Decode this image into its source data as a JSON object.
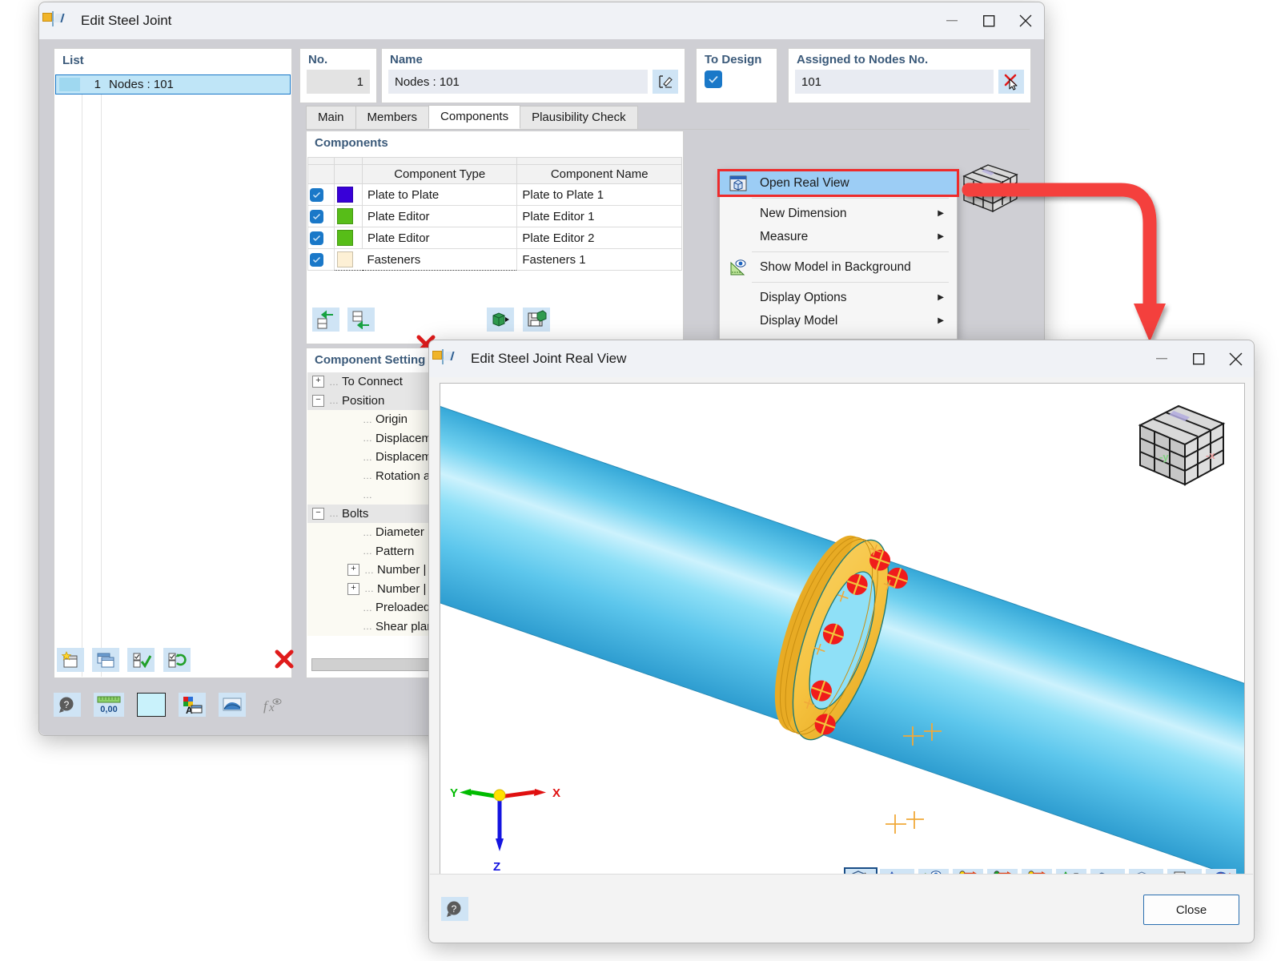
{
  "main_window": {
    "title": "Edit Steel Joint",
    "icon": "steel-joint-icon",
    "controls": {
      "minimize": "—",
      "maximize": "☐",
      "close": "✕"
    },
    "list_panel": {
      "header": "List",
      "rows": [
        {
          "num": "1",
          "label": "Nodes : 101",
          "color": "#9fd8f0"
        }
      ]
    },
    "fields": {
      "no_label": "No.",
      "no_value": "1",
      "name_label": "Name",
      "name_value": "Nodes : 101",
      "name_edit_icon": "edit-pencil-icon",
      "to_design_label": "To Design",
      "to_design_checked": true,
      "assigned_label": "Assigned to Nodes No.",
      "assigned_value": "101",
      "assigned_pick_icon": "select-nodes-icon"
    },
    "tabs": [
      {
        "label": "Main",
        "active": false
      },
      {
        "label": "Members",
        "active": false
      },
      {
        "label": "Components",
        "active": true
      },
      {
        "label": "Plausibility Check",
        "active": false
      }
    ],
    "components_panel": {
      "header": "Components",
      "columns": [
        "",
        "",
        "Component Type",
        "Component Name"
      ],
      "rows": [
        {
          "checked": true,
          "color": "#3800d8",
          "type": "Plate to Plate",
          "name": "Plate to Plate 1",
          "selected": false
        },
        {
          "checked": true,
          "color": "#57bd18",
          "type": "Plate Editor",
          "name": "Plate Editor 1",
          "selected": false
        },
        {
          "checked": true,
          "color": "#57bd18",
          "type": "Plate Editor",
          "name": "Plate Editor 2",
          "selected": false
        },
        {
          "checked": true,
          "color": "#fdf0d5",
          "type": "Fasteners",
          "name": "Fasteners 1",
          "selected": true
        }
      ],
      "toolbar": [
        {
          "name": "move-component-up-icon",
          "glyph": "⇦"
        },
        {
          "name": "move-component-down-icon",
          "glyph": "⇦"
        },
        {
          "name": "import-component-icon",
          "glyph": "▣"
        },
        {
          "name": "save-component-icon",
          "glyph": "Ὃe"
        },
        {
          "name": "delete-component-icon",
          "glyph": "✕"
        }
      ]
    },
    "component_settings": {
      "header": "Component Setting",
      "nodes": [
        {
          "label": "To Connect",
          "level": 0,
          "expander": "+"
        },
        {
          "label": "Position",
          "level": 0,
          "expander": "−"
        },
        {
          "label": "Origin",
          "level": 1,
          "expander": ""
        },
        {
          "label": "Displacemen",
          "level": 1,
          "expander": ""
        },
        {
          "label": "Displacemen",
          "level": 1,
          "expander": ""
        },
        {
          "label": "Rotation abo",
          "level": 1,
          "expander": ""
        },
        {
          "label": "",
          "level": 1,
          "expander": ""
        },
        {
          "label": "Bolts",
          "level": 0,
          "expander": "−"
        },
        {
          "label": "Diameter | St",
          "level": 1,
          "expander": ""
        },
        {
          "label": "Pattern",
          "level": 1,
          "expander": ""
        },
        {
          "label": "Number | Ra",
          "level": 1,
          "expander": "+"
        },
        {
          "label": "Number | An",
          "level": 1,
          "expander": "+"
        },
        {
          "label": "Preloaded bo",
          "level": 1,
          "expander": ""
        },
        {
          "label": "Shear plane i",
          "level": 1,
          "expander": ""
        }
      ],
      "toolbar": [
        {
          "name": "new-component-icon",
          "glyph": "★"
        },
        {
          "name": "copy-component-icon",
          "glyph": "❐"
        },
        {
          "name": "check-all-icon",
          "glyph": "✓"
        },
        {
          "name": "refresh-selection-icon",
          "glyph": "↻"
        },
        {
          "name": "delete-setting-icon",
          "glyph": "✕"
        }
      ]
    },
    "bottom_toolbar": [
      {
        "name": "help-icon",
        "glyph": "?"
      },
      {
        "name": "units-decimal-icon",
        "glyph": "0,00"
      },
      {
        "name": "color-preview-icon",
        "glyph": ""
      },
      {
        "name": "text-display-icon",
        "glyph": "A"
      },
      {
        "name": "render-view-icon",
        "glyph": "◩"
      },
      {
        "name": "formula-icon",
        "glyph": "fx"
      }
    ]
  },
  "context_menu": {
    "items": [
      {
        "label": "Open Real View",
        "icon": "open-real-view-icon",
        "selected": true,
        "submenu": false,
        "separator_after": true
      },
      {
        "label": "New Dimension",
        "icon": "",
        "selected": false,
        "submenu": true,
        "separator_after": false
      },
      {
        "label": "Measure",
        "icon": "",
        "selected": false,
        "submenu": true,
        "separator_after": true
      },
      {
        "label": "Show Model in Background",
        "icon": "show-model-icon",
        "selected": false,
        "submenu": false,
        "separator_after": true
      },
      {
        "label": "Display Options",
        "icon": "",
        "selected": false,
        "submenu": true,
        "separator_after": false
      },
      {
        "label": "Display Model",
        "icon": "",
        "selected": false,
        "submenu": true,
        "separator_after": false
      }
    ],
    "highlight_color": "#ee2b2b",
    "selected_bg": "#9ccdf5"
  },
  "annotation": {
    "arrow_color": "#f4403c",
    "name": "red-flow-arrow"
  },
  "real_view_window": {
    "title": "Edit Steel Joint Real View",
    "icon": "steel-joint-icon",
    "controls": {
      "minimize": "—",
      "maximize": "☐",
      "close": "✕"
    },
    "viewport": {
      "background": "#ffffff",
      "model": "bolted-pipe-flange-connection",
      "pipe_color": "#7fd6f5",
      "flange_color": "#f6c445",
      "bolt_color": "#f01c1c",
      "gasket_color": "#ea9a92",
      "nav_cube": {
        "name": "navigation-cube",
        "face_labels": [
          "-y",
          "-x"
        ]
      },
      "axes": {
        "x": "X",
        "y": "Y",
        "z": "Z",
        "x_color": "#e01010",
        "y_color": "#00bb00",
        "z_color": "#1414e0"
      }
    },
    "toolbar": [
      {
        "name": "rotate-view-icon",
        "glyph": "⟳",
        "caret": false,
        "selected": true
      },
      {
        "name": "isometric-view-icon",
        "glyph": "✕",
        "caret": true,
        "selected": false
      },
      {
        "name": "measure-view-icon",
        "glyph": "◢",
        "caret": false,
        "selected": false
      },
      {
        "name": "view-in-x-icon",
        "glyph": "X",
        "caret": false,
        "selected": false
      },
      {
        "name": "view-in-minus-y-icon",
        "glyph": "-Y",
        "caret": false,
        "selected": false
      },
      {
        "name": "view-in-z-icon",
        "glyph": "Z",
        "caret": false,
        "selected": false
      },
      {
        "name": "view-in-minus-z-icon",
        "glyph": "-Z",
        "caret": false,
        "selected": false
      },
      {
        "name": "render-mode-icon",
        "glyph": "◰",
        "caret": true,
        "selected": false
      },
      {
        "name": "wireframe-mode-icon",
        "glyph": "⬚",
        "caret": true,
        "selected": false
      },
      {
        "name": "print-icon",
        "glyph": "⎙",
        "caret": true,
        "selected": false
      },
      {
        "name": "reset-view-icon",
        "glyph": "↺",
        "caret": false,
        "selected": false
      }
    ],
    "footer": {
      "help_icon": "help-icon",
      "close_button": "Close"
    }
  }
}
